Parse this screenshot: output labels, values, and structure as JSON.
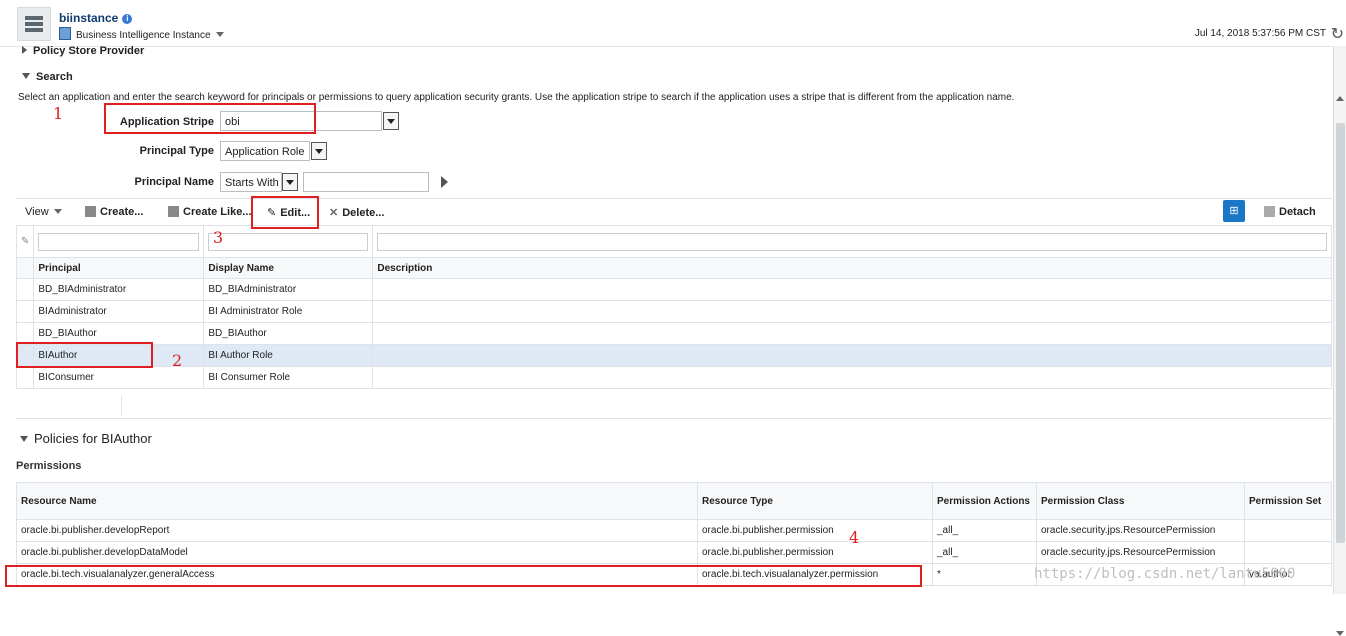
{
  "header": {
    "title": "biinstance",
    "subtitle": "Business Intelligence Instance",
    "timestamp": "Jul 14, 2018 5:37:56 PM CST"
  },
  "sections": {
    "policy_store": "Policy Store Provider",
    "search": "Search"
  },
  "search": {
    "instructions": "Select an application and enter the search keyword for principals or permissions to query application security grants. Use the application stripe to search if the application uses a stripe that is different from the application name.",
    "stripe_label": "Application Stripe",
    "stripe_value": "obi",
    "principal_type_label": "Principal Type",
    "principal_type_value": "Application Role",
    "principal_name_label": "Principal Name",
    "principal_name_op": "Starts With"
  },
  "toolbar": {
    "view": "View",
    "create": "Create...",
    "create_like": "Create Like...",
    "edit": "Edit...",
    "delete": "Delete...",
    "detach": "Detach"
  },
  "principals": {
    "headers": [
      "Principal",
      "Display Name",
      "Description"
    ],
    "rows": [
      [
        "BD_BIAdministrator",
        "BD_BIAdministrator",
        ""
      ],
      [
        "BIAdministrator",
        "BI Administrator Role",
        ""
      ],
      [
        "BD_BIAuthor",
        "BD_BIAuthor",
        ""
      ],
      [
        "BIAuthor",
        "BI Author Role",
        ""
      ],
      [
        "BIConsumer",
        "BI Consumer Role",
        ""
      ]
    ],
    "selected_index": 3
  },
  "policies": {
    "title": "Policies for BIAuthor",
    "permissions_label": "Permissions",
    "headers": [
      "Resource Name",
      "Resource Type",
      "Permission Actions",
      "Permission Class",
      "Permission Set"
    ],
    "rows": [
      [
        "oracle.bi.publisher.developReport",
        "oracle.bi.publisher.permission",
        "_all_",
        "oracle.security.jps.ResourcePermission",
        ""
      ],
      [
        "oracle.bi.publisher.developDataModel",
        "oracle.bi.publisher.permission",
        "_all_",
        "oracle.security.jps.ResourcePermission",
        ""
      ],
      [
        "oracle.bi.tech.visualanalyzer.generalAccess",
        "oracle.bi.tech.visualanalyzer.permission",
        "*",
        "",
        "va.author"
      ]
    ]
  },
  "annotations": [
    "1",
    "2",
    "3",
    "4"
  ],
  "watermark": "https://blog.csdn.net/lantu5000",
  "colors": {
    "highlight": "#e02020",
    "selected_row": "#dfe9f5",
    "title": "#0f3b6e"
  }
}
